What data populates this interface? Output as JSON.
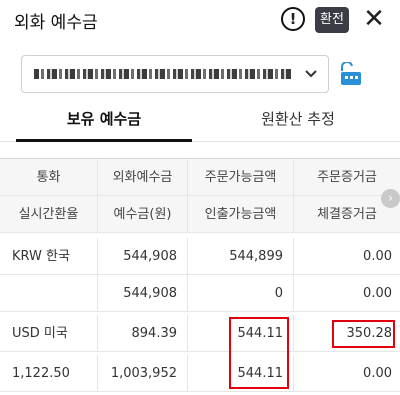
{
  "header": {
    "title": "외화 예수금",
    "exchange_label": "환전",
    "alert_glyph": "!",
    "close_glyph": "✕"
  },
  "account": {
    "masked_value": "",
    "chevron_icon": "chevron-down-icon",
    "lock_icon": "lock-icon"
  },
  "tabs": [
    {
      "label": "보유 예수금",
      "active": true
    },
    {
      "label": "원환산 추정",
      "active": false
    }
  ],
  "table": {
    "header_row1": [
      "통화",
      "외화예수금",
      "주문가능금액",
      "주문증거금"
    ],
    "header_row2": [
      "실시간환율",
      "예수금(원)",
      "인출가능금액",
      "체결증거금"
    ],
    "rows": [
      [
        "KRW 한국",
        "544,908",
        "544,899",
        "0.00"
      ],
      [
        "",
        "544,908",
        "0",
        "0.00"
      ],
      [
        "USD 미국",
        "894.39",
        "544.11",
        "350.28"
      ],
      [
        "1,122.50",
        "1,003,952",
        "544.11",
        "0.00"
      ]
    ]
  },
  "colors": {
    "highlight": "#e3000f",
    "exchange_button": "#3a3d44",
    "lock_icon": "#2a8fd6"
  }
}
